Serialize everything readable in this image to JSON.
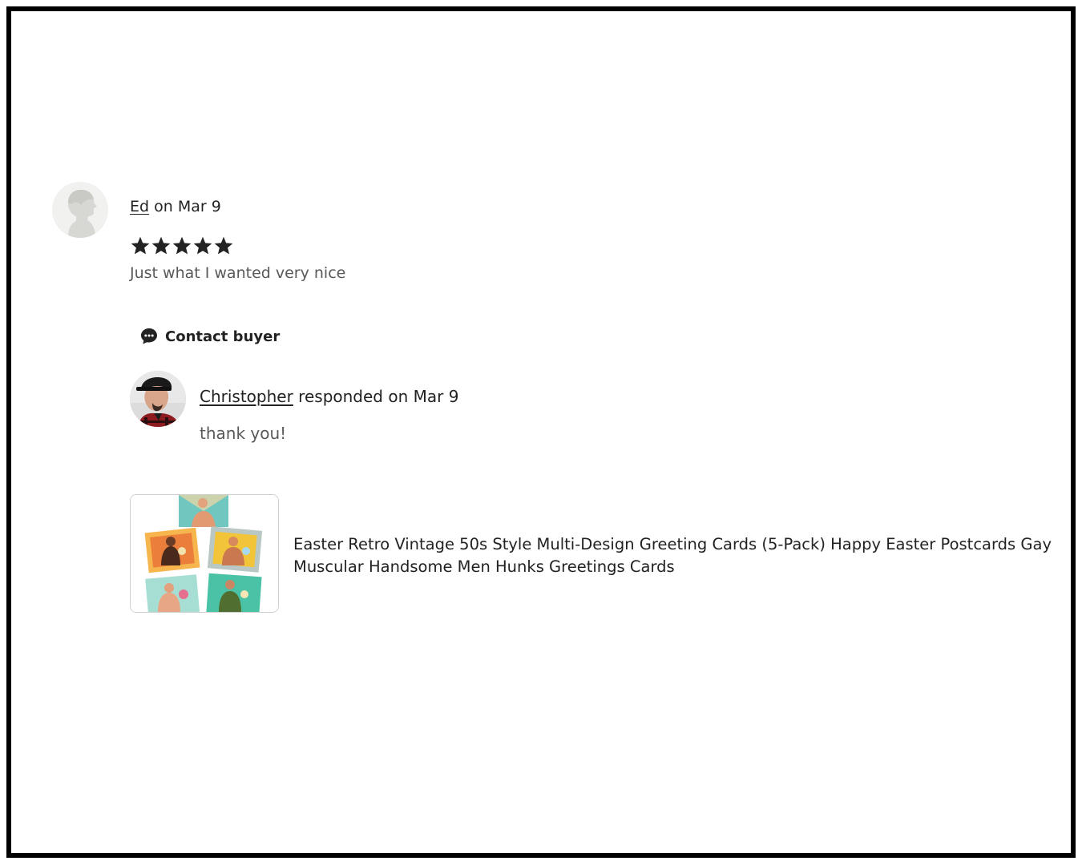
{
  "review": {
    "reviewer_name": "Ed",
    "date_text": " on Mar 9",
    "rating": 5,
    "rating_max": 5,
    "text": "Just what I wanted very nice"
  },
  "contact_button": {
    "label": "Contact buyer",
    "icon": "chat-bubble-icon"
  },
  "response": {
    "seller_name": "Christopher",
    "date_text": " responded on Mar 9",
    "text": "thank you!"
  },
  "listing": {
    "title": "Easter Retro Vintage 50s Style Multi-Design Greeting Cards (5-Pack) Happy Easter Postcards Gay Muscular Handsome Men Hunks Greetings Cards"
  },
  "colors": {
    "text_primary": "#222222",
    "text_secondary": "#595959",
    "star_fill": "#222222",
    "frame_border": "#000000"
  }
}
